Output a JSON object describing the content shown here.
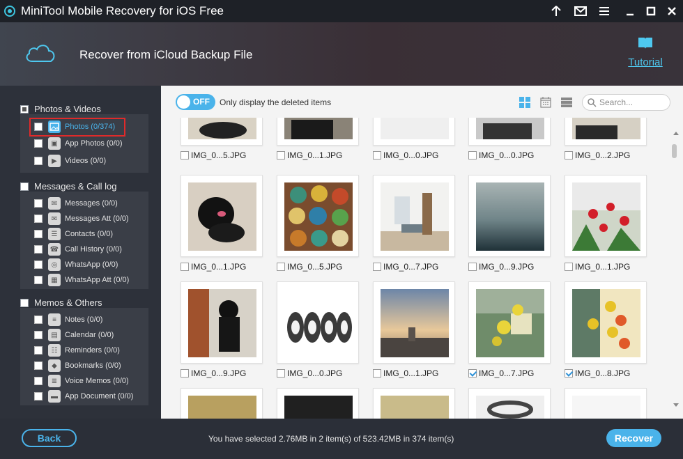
{
  "window": {
    "title": "MiniTool Mobile Recovery for iOS Free"
  },
  "header": {
    "title": "Recover from iCloud Backup File",
    "tutorial_label": "Tutorial"
  },
  "sidebar": {
    "groups": [
      {
        "label": "Photos & Videos",
        "items": [
          {
            "label": "Photos (0/374)",
            "icon": "photo-icon",
            "active": true
          },
          {
            "label": "App Photos (0/0)",
            "icon": "app-photo-icon"
          },
          {
            "label": "Videos (0/0)",
            "icon": "video-icon"
          }
        ]
      },
      {
        "label": "Messages & Call log",
        "items": [
          {
            "label": "Messages (0/0)",
            "icon": "message-icon"
          },
          {
            "label": "Messages Att (0/0)",
            "icon": "message-attachment-icon"
          },
          {
            "label": "Contacts (0/0)",
            "icon": "contacts-icon"
          },
          {
            "label": "Call History (0/0)",
            "icon": "call-history-icon"
          },
          {
            "label": "WhatsApp (0/0)",
            "icon": "whatsapp-icon"
          },
          {
            "label": "WhatsApp Att (0/0)",
            "icon": "whatsapp-attachment-icon"
          }
        ]
      },
      {
        "label": "Memos & Others",
        "items": [
          {
            "label": "Notes (0/0)",
            "icon": "notes-icon"
          },
          {
            "label": "Calendar (0/0)",
            "icon": "calendar-icon"
          },
          {
            "label": "Reminders (0/0)",
            "icon": "reminders-icon"
          },
          {
            "label": "Bookmarks (0/0)",
            "icon": "bookmarks-icon"
          },
          {
            "label": "Voice Memos (0/0)",
            "icon": "voice-memo-icon"
          },
          {
            "label": "App Document (0/0)",
            "icon": "app-document-icon"
          }
        ]
      }
    ]
  },
  "toolbar": {
    "toggle_state": "OFF",
    "toggle_caption": "Only display the deleted items",
    "search_placeholder": "Search..."
  },
  "files": [
    {
      "name": "IMG_0...5.JPG",
      "checked": false
    },
    {
      "name": "IMG_0...1.JPG",
      "checked": false
    },
    {
      "name": "IMG_0...0.JPG",
      "checked": false
    },
    {
      "name": "IMG_0...0.JPG",
      "checked": false
    },
    {
      "name": "IMG_0...2.JPG",
      "checked": false
    },
    {
      "name": "IMG_0...1.JPG",
      "checked": false
    },
    {
      "name": "IMG_0...5.JPG",
      "checked": false
    },
    {
      "name": "IMG_0...7.JPG",
      "checked": false
    },
    {
      "name": "IMG_0...9.JPG",
      "checked": false
    },
    {
      "name": "IMG_0...1.JPG",
      "checked": false
    },
    {
      "name": "IMG_0...9.JPG",
      "checked": false
    },
    {
      "name": "IMG_0...0.JPG",
      "checked": false
    },
    {
      "name": "IMG_0...1.JPG",
      "checked": false
    },
    {
      "name": "IMG_0...7.JPG",
      "checked": true
    },
    {
      "name": "IMG_0...8.JPG",
      "checked": true
    }
  ],
  "footer": {
    "back_label": "Back",
    "status": "You have selected 2.76MB in 2 item(s) of 523.42MB in 374 item(s)",
    "recover_label": "Recover"
  },
  "colors": {
    "accent": "#4ab3ea",
    "highlight": "#e02a2a"
  }
}
